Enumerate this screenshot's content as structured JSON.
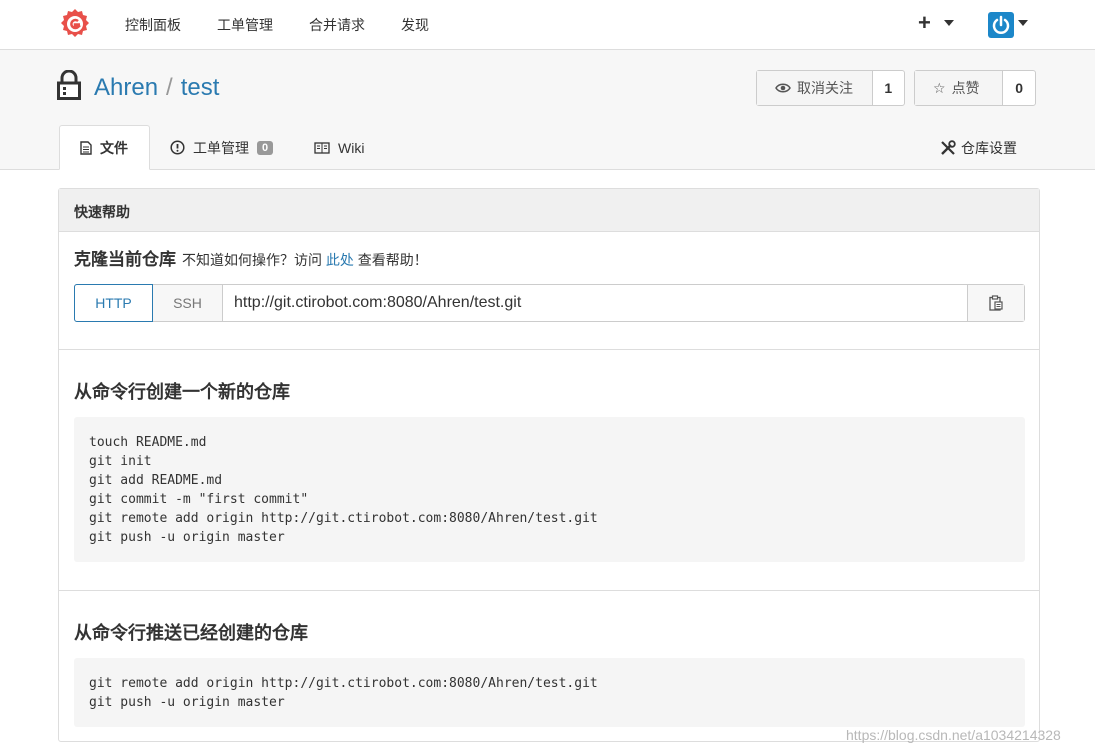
{
  "topnav": {
    "items": [
      "控制面板",
      "工单管理",
      "合并请求",
      "发现"
    ],
    "plus_label": "+"
  },
  "repo": {
    "owner": "Ahren",
    "separator": "/",
    "name": "test",
    "watch": {
      "label": "取消关注",
      "count": "1"
    },
    "star": {
      "label": "点赞",
      "count": "0"
    }
  },
  "tabs": {
    "files": "文件",
    "issues": "工单管理",
    "issues_count": "0",
    "wiki": "Wiki",
    "settings": "仓库设置"
  },
  "panel": {
    "header": "快速帮助",
    "clone_title": "克隆当前仓库",
    "clone_hint_before": "不知道如何操作？访问",
    "clone_hint_link": "此处",
    "clone_hint_after": "查看帮助！",
    "http_label": "HTTP",
    "ssh_label": "SSH",
    "clone_url": "http://git.ctirobot.com:8080/Ahren/test.git"
  },
  "section_new": {
    "title": "从命令行创建一个新的仓库",
    "lines": [
      "touch README.md",
      "git init",
      "git add README.md",
      "git commit -m \"first commit\"",
      "git remote add origin http://git.ctirobot.com:8080/Ahren/test.git",
      "git push -u origin master"
    ]
  },
  "section_existing": {
    "title": "从命令行推送已经创建的仓库",
    "lines": [
      "git remote add origin http://git.ctirobot.com:8080/Ahren/test.git",
      "git push -u origin master"
    ]
  },
  "watermark": "https://blog.csdn.net/a1034214328",
  "colors": {
    "accent": "#2a7ab0",
    "logo": "#e8504a",
    "avatar": "#1c87c9"
  }
}
